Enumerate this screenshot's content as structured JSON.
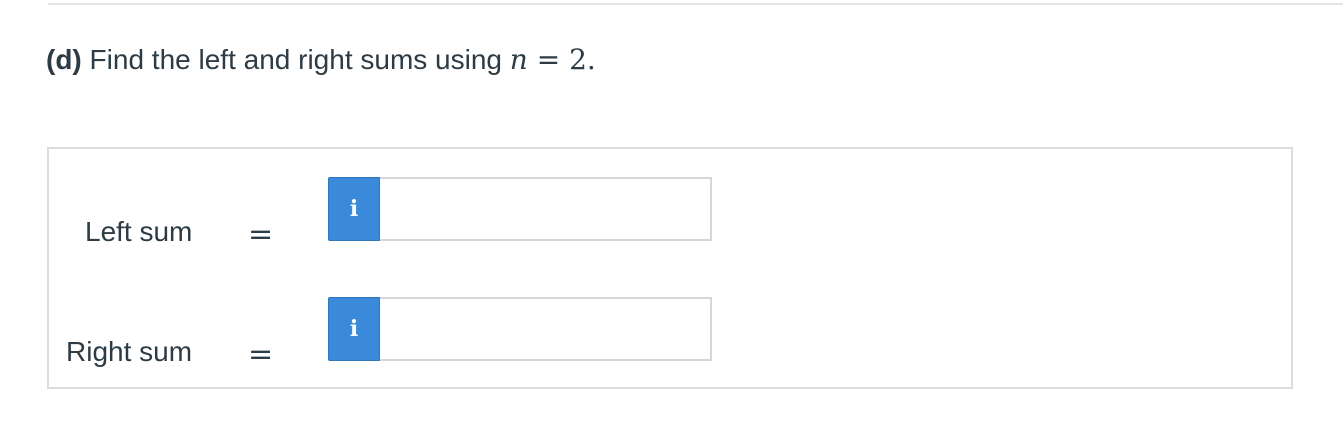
{
  "question": {
    "part_label": "(d)",
    "text": " Find the left and right sums using ",
    "math_var": "n",
    "math_rest": " = 2."
  },
  "rows": [
    {
      "label": "Left sum",
      "equals": "=",
      "info_icon": "i",
      "input_value": ""
    },
    {
      "label": "Right sum",
      "equals": "=",
      "info_icon": "i",
      "input_value": ""
    }
  ],
  "colors": {
    "info_button": "#3b8ad9",
    "text": "#2d3b45",
    "border": "#dcdcdc"
  }
}
